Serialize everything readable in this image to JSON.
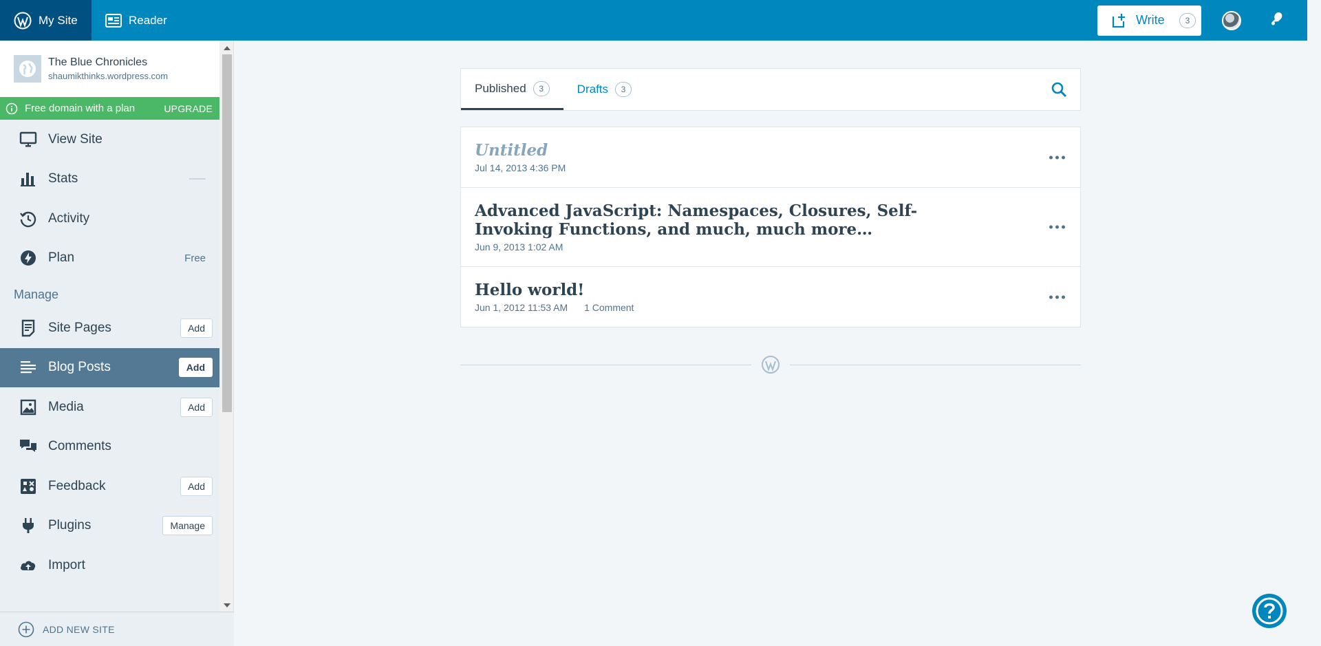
{
  "masterbar": {
    "my_site": "My Site",
    "reader": "Reader",
    "write": "Write",
    "write_count": "3"
  },
  "site": {
    "title": "The Blue Chronicles",
    "url": "shaumikthinks.wordpress.com"
  },
  "upsell": {
    "label": "Free domain with a plan",
    "cta": "UPGRADE"
  },
  "sidebar": {
    "items": [
      {
        "label": "View Site"
      },
      {
        "label": "Stats"
      },
      {
        "label": "Activity"
      },
      {
        "label": "Plan",
        "badge": "Free"
      }
    ],
    "manage_heading": "Manage",
    "manage_items": [
      {
        "label": "Site Pages",
        "button": "Add"
      },
      {
        "label": "Blog Posts",
        "button": "Add"
      },
      {
        "label": "Media",
        "button": "Add"
      },
      {
        "label": "Comments"
      },
      {
        "label": "Feedback",
        "button": "Add"
      },
      {
        "label": "Plugins",
        "button": "Manage"
      },
      {
        "label": "Import"
      }
    ],
    "add_new_site": "ADD NEW SITE"
  },
  "tabs": [
    {
      "label": "Published",
      "count": "3"
    },
    {
      "label": "Drafts",
      "count": "3"
    }
  ],
  "posts": [
    {
      "title": "Untitled",
      "date": "Jul 14, 2013 4:36 PM",
      "comments": ""
    },
    {
      "title": "Advanced JavaScript: Namespaces, Closures, Self-Invoking Functions, and much, much more…",
      "date": "Jun 9, 2013 1:02 AM",
      "comments": ""
    },
    {
      "title": "Hello world!",
      "date": "Jun 1, 2012 11:53 AM",
      "comments": "1 Comment"
    }
  ],
  "colors": {
    "masterbar": "#0087be",
    "masterbar_active": "#005082",
    "upsell": "#4ab866",
    "selected_nav": "#537994"
  }
}
